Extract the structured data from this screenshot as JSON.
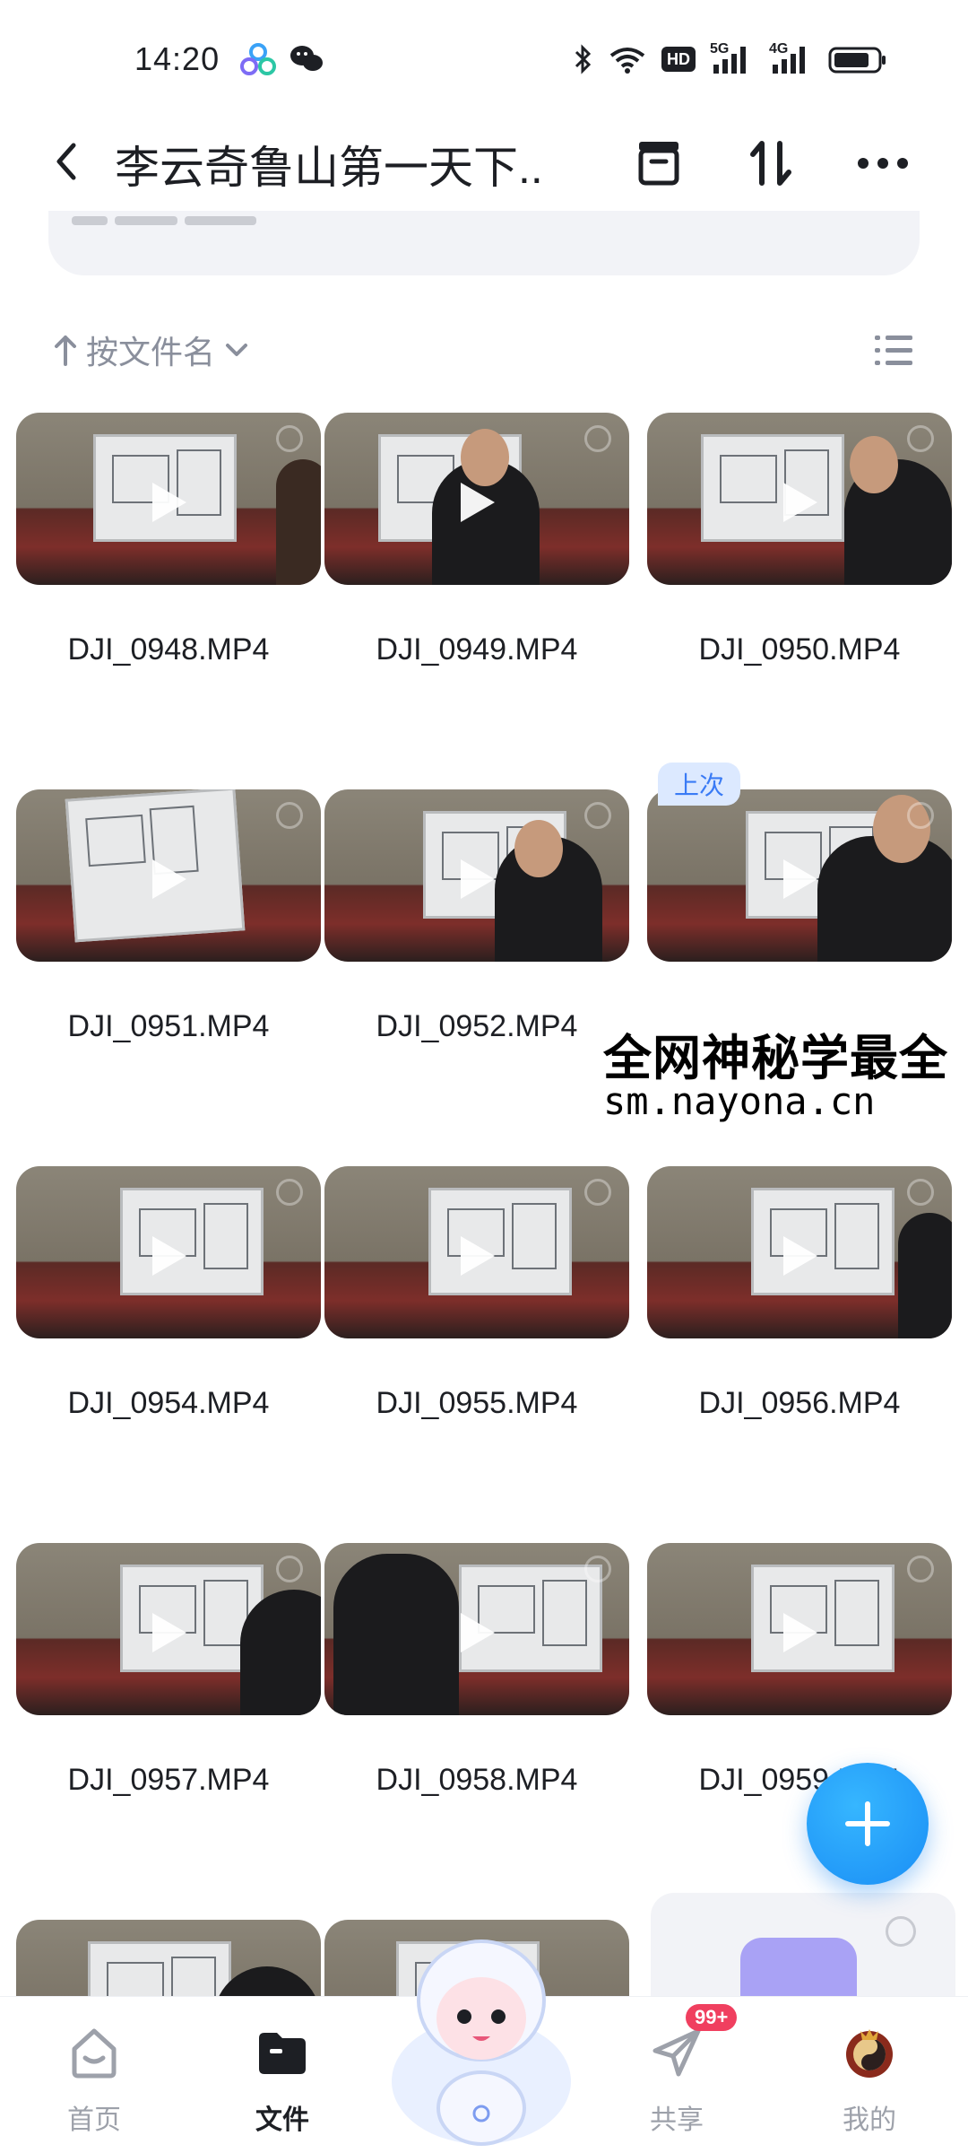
{
  "status_bar": {
    "time": "14:20",
    "network_5g": "5G",
    "network_4g": "4G",
    "hd_label": "HD"
  },
  "header": {
    "title": "李云奇鲁山第一天下..."
  },
  "sort": {
    "label": "按文件名"
  },
  "files": [
    {
      "name": "DJI_0948.MP4"
    },
    {
      "name": "DJI_0949.MP4"
    },
    {
      "name": "DJI_0950.MP4"
    },
    {
      "name": "DJI_0951.MP4"
    },
    {
      "name": "DJI_0952.MP4"
    },
    {
      "name": "",
      "tag": "上次"
    },
    {
      "name": "DJI_0954.MP4"
    },
    {
      "name": "DJI_0955.MP4"
    },
    {
      "name": "DJI_0956.MP4"
    },
    {
      "name": "DJI_0957.MP4"
    },
    {
      "name": "DJI_0958.MP4"
    },
    {
      "name": "DJI_0959.MP4"
    }
  ],
  "watermark": {
    "line1": "全网神秘学最全",
    "line2": "sm.nayona.cn"
  },
  "bottom_nav": {
    "home": "首页",
    "files": "文件",
    "share": "共享",
    "share_badge": "99+",
    "mine": "我的"
  },
  "colors": {
    "accent": "#1a8ef5",
    "badge": "#f03f5f",
    "tag_bg": "#dce9ff",
    "tag_text": "#3a7bf5"
  }
}
